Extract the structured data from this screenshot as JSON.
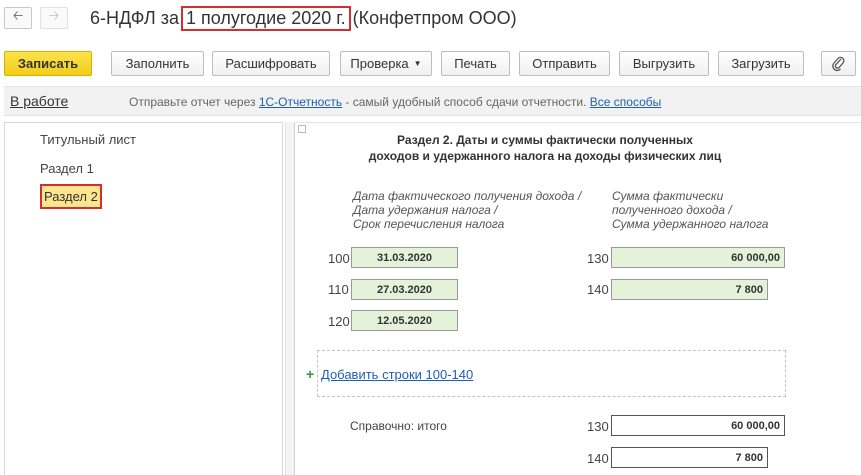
{
  "nav": {
    "back_icon": "arrow-left-icon",
    "forward_icon": "arrow-right-icon"
  },
  "header": {
    "title_prefix": "6-НДФЛ за",
    "period": "1 полугодие 2020 г.",
    "org": "(Конфетпром ООО)"
  },
  "toolbar": {
    "save": "Записать",
    "fill": "Заполнить",
    "decode": "Расшифровать",
    "check": "Проверка",
    "print": "Печать",
    "send": "Отправить",
    "export": "Выгрузить",
    "import": "Загрузить",
    "attach_icon": "paperclip-icon"
  },
  "infobar": {
    "status": "В работе",
    "text_before": "Отправьте отчет через ",
    "service_link": "1С-Отчетность",
    "text_after": " - самый удобный способ сдачи отчетности. ",
    "all_methods": "Все способы"
  },
  "sections": [
    {
      "label": "Титульный лист",
      "active": false
    },
    {
      "label": "Раздел 1",
      "active": false
    },
    {
      "label": "Раздел 2",
      "active": true
    }
  ],
  "form": {
    "title_line1": "Раздел 2.  Даты и суммы фактически полученных",
    "title_line2": "доходов и удержанного налога на доходы физических лиц",
    "col_left": [
      "Дата фактического получения дохода /",
      "Дата удержания налога /",
      "Срок перечисления налога"
    ],
    "col_right": [
      "Сумма фактически",
      "полученного дохода /",
      "Сумма удержанного налога"
    ],
    "rows_left": [
      {
        "code": "100",
        "value": "31.03.2020"
      },
      {
        "code": "110",
        "value": "27.03.2020"
      },
      {
        "code": "120",
        "value": "12.05.2020"
      }
    ],
    "rows_right": [
      {
        "code": "130",
        "value": "60 000,00"
      },
      {
        "code": "140",
        "value": "7 800"
      }
    ],
    "add_rows_link": "Добавить строки 100-140",
    "reference_label": "Справочно: итого",
    "totals": [
      {
        "code": "130",
        "value": "60 000,00"
      },
      {
        "code": "140",
        "value": "7 800"
      }
    ]
  }
}
